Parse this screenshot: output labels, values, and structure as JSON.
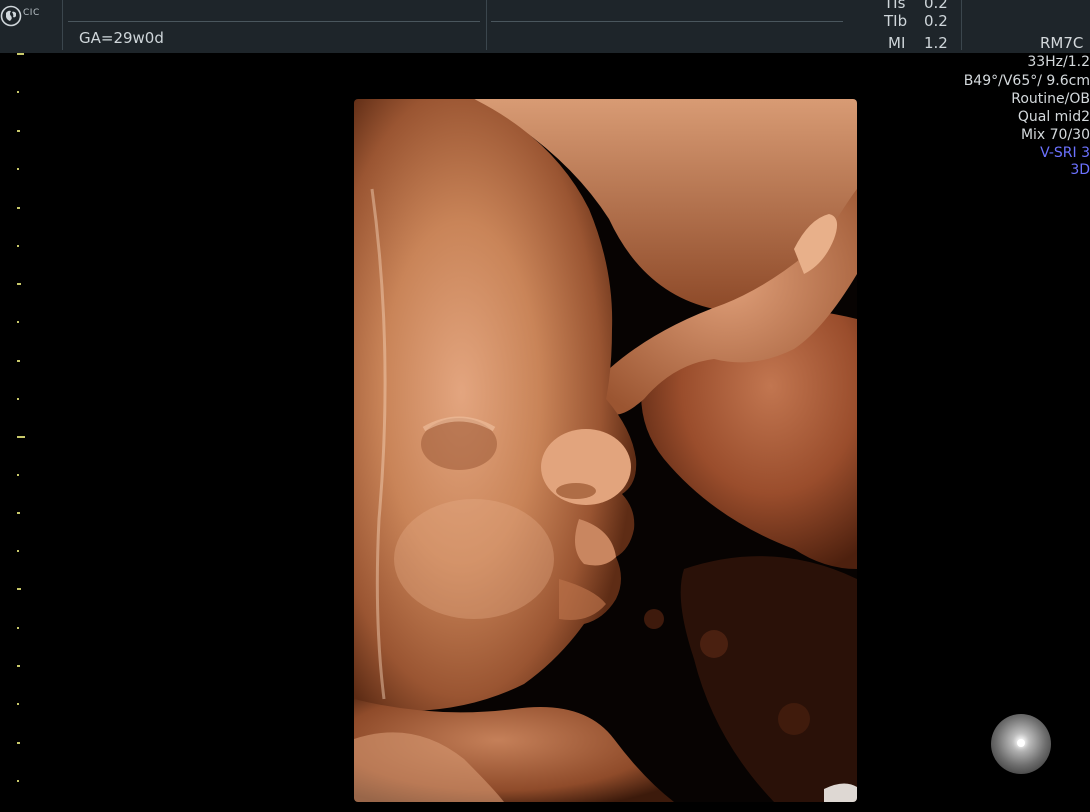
{
  "header": {
    "logo_text": "CIC",
    "ga": "GA=29w0d",
    "metrics": [
      {
        "label": "TIs",
        "value": "0.2"
      },
      {
        "label": "TIb",
        "value": "0.2"
      },
      {
        "label": "MI",
        "value": "1.2"
      }
    ]
  },
  "probe": "RM7C",
  "info_panel": [
    {
      "text": "33Hz/1.2",
      "accent": false
    },
    {
      "text": "B49°/V65°/ 9.6cm",
      "accent": false
    },
    {
      "text": "Routine/OB",
      "accent": false
    },
    {
      "text": "Qual mid2",
      "accent": false
    },
    {
      "text": "Mix 70/30",
      "accent": false
    },
    {
      "text": "V-SRI 3",
      "accent": true
    },
    {
      "text": "3D",
      "accent": true
    }
  ],
  "colors": {
    "background": "#000000",
    "header_bg": "#1e252a",
    "text": "#d4d9dc",
    "accent": "#6c72ff",
    "scale_tick": "#c9c96a",
    "render_skin": "#c7805a"
  },
  "icons": {
    "logo": "ge-logo-icon",
    "trackball": "trackball-orb-icon"
  }
}
